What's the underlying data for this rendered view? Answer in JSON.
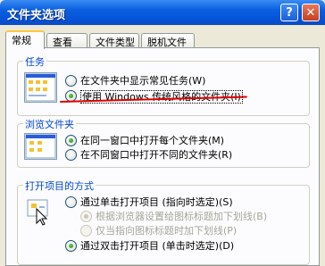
{
  "window": {
    "title": "文件夹选项",
    "help_glyph": "?",
    "close_glyph": "✕"
  },
  "tabs": [
    "常规",
    "查看",
    "文件类型",
    "脱机文件"
  ],
  "tasks": {
    "label": "任务",
    "options": [
      {
        "text": "在文件夹中显示常见任务",
        "key": "(W)",
        "checked": false
      },
      {
        "text": "使用 Windows 传统风格的文件夹",
        "key": "(I)",
        "checked": true
      }
    ]
  },
  "browse": {
    "label": "浏览文件夹",
    "options": [
      {
        "text": "在同一窗口中打开每个文件夹",
        "key": "(M)",
        "checked": true
      },
      {
        "text": "在不同窗口中打开不同的文件夹",
        "key": "(R)",
        "checked": false
      }
    ]
  },
  "click": {
    "label": "打开项目的方式",
    "options": [
      {
        "text": "通过单击打开项目 (指向时选定)",
        "key": "(S)",
        "checked": false
      },
      {
        "text": "根据浏览器设置给图标标题加下划线",
        "key": "(B)",
        "checked": true,
        "disabled": true
      },
      {
        "text": "仅当指向图标标题时加下划线",
        "key": "(P)",
        "checked": false,
        "disabled": true
      },
      {
        "text": "通过双击打开项目 (单击时选定)",
        "key": "(D)",
        "checked": true
      }
    ]
  },
  "colors": {
    "accent": "#0046d5",
    "title_bar": "#0552d6",
    "annotation": "#e00000"
  }
}
